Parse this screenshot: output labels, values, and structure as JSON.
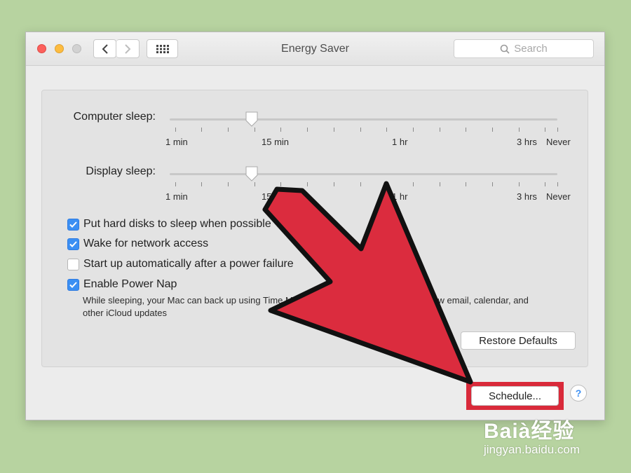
{
  "window": {
    "title": "Energy Saver"
  },
  "search": {
    "placeholder": "Search",
    "icon": "search-icon"
  },
  "sliders": [
    {
      "label": "Computer sleep:",
      "value": "15 min",
      "tick_labels": [
        "1 min",
        "15 min",
        "1 hr",
        "3 hrs",
        "Never"
      ]
    },
    {
      "label": "Display sleep:",
      "value": "15 min",
      "tick_labels": [
        "1 min",
        "15 min",
        "1 hr",
        "3 hrs",
        "Never"
      ]
    }
  ],
  "options": [
    {
      "label": "Put hard disks to sleep when possible",
      "checked": true
    },
    {
      "label": "Wake for network access",
      "checked": true
    },
    {
      "label": "Start up automatically after a power failure",
      "checked": false
    },
    {
      "label": "Enable Power Nap",
      "checked": true
    }
  ],
  "power_nap_description": "While sleeping, your Mac can back up using Time Machine and periodically check for new email, calendar, and other iCloud updates",
  "buttons": {
    "restore_defaults": "Restore Defaults",
    "schedule": "Schedule...",
    "help": "?"
  },
  "watermark": {
    "logo": "Baià经验",
    "url": "jingyan.baidu.com"
  },
  "colors": {
    "accent": "#3b8ff3",
    "highlight": "#d92a3a",
    "background": "#b7d3a0"
  }
}
